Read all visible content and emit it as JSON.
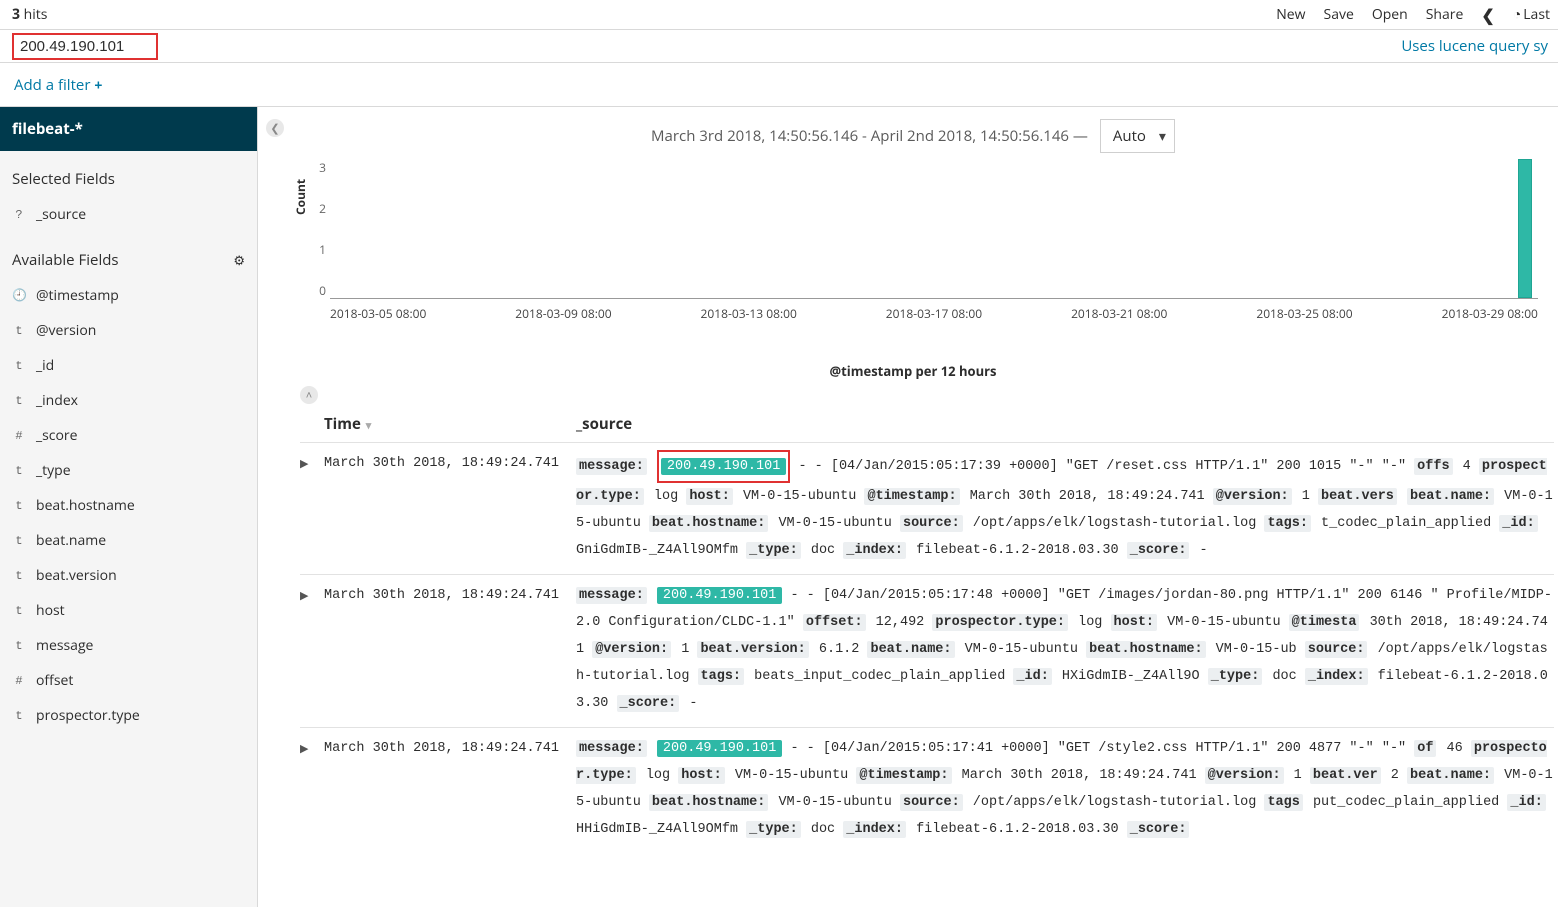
{
  "top": {
    "hits_count": "3",
    "hits_label": "hits",
    "actions": {
      "new": "New",
      "save": "Save",
      "open": "Open",
      "share": "Share",
      "last": "Last"
    }
  },
  "search": {
    "query": "200.49.190.101",
    "lucene_hint": "Uses lucene query sy"
  },
  "filter": {
    "add": "Add a filter"
  },
  "sidebar": {
    "index_pattern": "filebeat-*",
    "selected_title": "Selected Fields",
    "available_title": "Available Fields",
    "selected_fields": [
      {
        "type": "?",
        "name": "_source"
      }
    ],
    "available_fields": [
      {
        "type": "🕘",
        "name": "@timestamp"
      },
      {
        "type": "t",
        "name": "@version"
      },
      {
        "type": "t",
        "name": "_id"
      },
      {
        "type": "t",
        "name": "_index"
      },
      {
        "type": "#",
        "name": "_score"
      },
      {
        "type": "t",
        "name": "_type"
      },
      {
        "type": "t",
        "name": "beat.hostname"
      },
      {
        "type": "t",
        "name": "beat.name"
      },
      {
        "type": "t",
        "name": "beat.version"
      },
      {
        "type": "t",
        "name": "host"
      },
      {
        "type": "t",
        "name": "message"
      },
      {
        "type": "#",
        "name": "offset"
      },
      {
        "type": "t",
        "name": "prospector.type"
      }
    ]
  },
  "chart": {
    "time_range": "March 3rd 2018, 14:50:56.146 - April 2nd 2018, 14:50:56.146 —",
    "interval": "Auto",
    "x_title": "@timestamp per 12 hours"
  },
  "chart_data": {
    "type": "bar",
    "title": "",
    "xlabel": "@timestamp per 12 hours",
    "ylabel": "Count",
    "ylim": [
      0,
      3
    ],
    "y_ticks": [
      "3",
      "2",
      "1",
      "0"
    ],
    "x_ticks": [
      "2018-03-05 08:00",
      "2018-03-09 08:00",
      "2018-03-13 08:00",
      "2018-03-17 08:00",
      "2018-03-21 08:00",
      "2018-03-25 08:00",
      "2018-03-29 08:00"
    ],
    "categories": [
      "2018-03-30"
    ],
    "values": [
      3
    ]
  },
  "table": {
    "columns": {
      "time": "Time",
      "source": "_source"
    },
    "rows": [
      {
        "time": "March 30th 2018, 18:49:24.741",
        "source_html": "<span class='kv-key'>message:</span> <span class='hl-box'><span class='hl'>200.49.190.101</span></span> - - [04/Jan/2015:05:17:39 +0000] \"GET /reset.css HTTP/1.1\" 200 1015 \"-\" \"-\" <span class='kv-key'>offs</span> 4 <span class='kv-key'>prospector.type:</span> log <span class='kv-key'>host:</span> VM-0-15-ubuntu <span class='kv-key'>@timestamp:</span> March 30th 2018, 18:49:24.741 <span class='kv-key'>@version:</span> 1 <span class='kv-key'>beat.vers</span> <span class='kv-key'>beat.name:</span> VM-0-15-ubuntu <span class='kv-key'>beat.hostname:</span> VM-0-15-ubuntu <span class='kv-key'>source:</span> /opt/apps/elk/logstash-tutorial.log <span class='kv-key'>tags:</span> t_codec_plain_applied <span class='kv-key'>_id:</span> GniGdmIB-_Z4All9OMfm <span class='kv-key'>_type:</span> doc <span class='kv-key'>_index:</span> filebeat-6.1.2-2018.03.30 <span class='kv-key'>_score:</span> -"
      },
      {
        "time": "March 30th 2018, 18:49:24.741",
        "source_html": "<span class='kv-key'>message:</span> <span class='hl'>200.49.190.101</span> - - [04/Jan/2015:05:17:48 +0000] \"GET /images/jordan-80.png HTTP/1.1\" 200 6146 \" Profile/MIDP-2.0 Configuration/CLDC-1.1\" <span class='kv-key'>offset:</span> 12,492 <span class='kv-key'>prospector.type:</span> log <span class='kv-key'>host:</span> VM-0-15-ubuntu <span class='kv-key'>@timesta</span> 30th 2018, 18:49:24.741 <span class='kv-key'>@version:</span> 1 <span class='kv-key'>beat.version:</span> 6.1.2 <span class='kv-key'>beat.name:</span> VM-0-15-ubuntu <span class='kv-key'>beat.hostname:</span> VM-0-15-ub <span class='kv-key'>source:</span> /opt/apps/elk/logstash-tutorial.log <span class='kv-key'>tags:</span> beats_input_codec_plain_applied <span class='kv-key'>_id:</span> HXiGdmIB-_Z4All9O <span class='kv-key'>_type:</span> doc <span class='kv-key'>_index:</span> filebeat-6.1.2-2018.03.30 <span class='kv-key'>_score:</span> -"
      },
      {
        "time": "March 30th 2018, 18:49:24.741",
        "source_html": "<span class='kv-key'>message:</span> <span class='hl'>200.49.190.101</span> - - [04/Jan/2015:05:17:41 +0000] \"GET /style2.css HTTP/1.1\" 200 4877 \"-\" \"-\" <span class='kv-key'>of</span> 46 <span class='kv-key'>prospector.type:</span> log <span class='kv-key'>host:</span> VM-0-15-ubuntu <span class='kv-key'>@timestamp:</span> March 30th 2018, 18:49:24.741 <span class='kv-key'>@version:</span> 1 <span class='kv-key'>beat.ver</span> 2 <span class='kv-key'>beat.name:</span> VM-0-15-ubuntu <span class='kv-key'>beat.hostname:</span> VM-0-15-ubuntu <span class='kv-key'>source:</span> /opt/apps/elk/logstash-tutorial.log <span class='kv-key'>tags</span> put_codec_plain_applied <span class='kv-key'>_id:</span> HHiGdmIB-_Z4All9OMfm <span class='kv-key'>_type:</span> doc <span class='kv-key'>_index:</span> filebeat-6.1.2-2018.03.30 <span class='kv-key'>_score:</span>"
      }
    ]
  }
}
